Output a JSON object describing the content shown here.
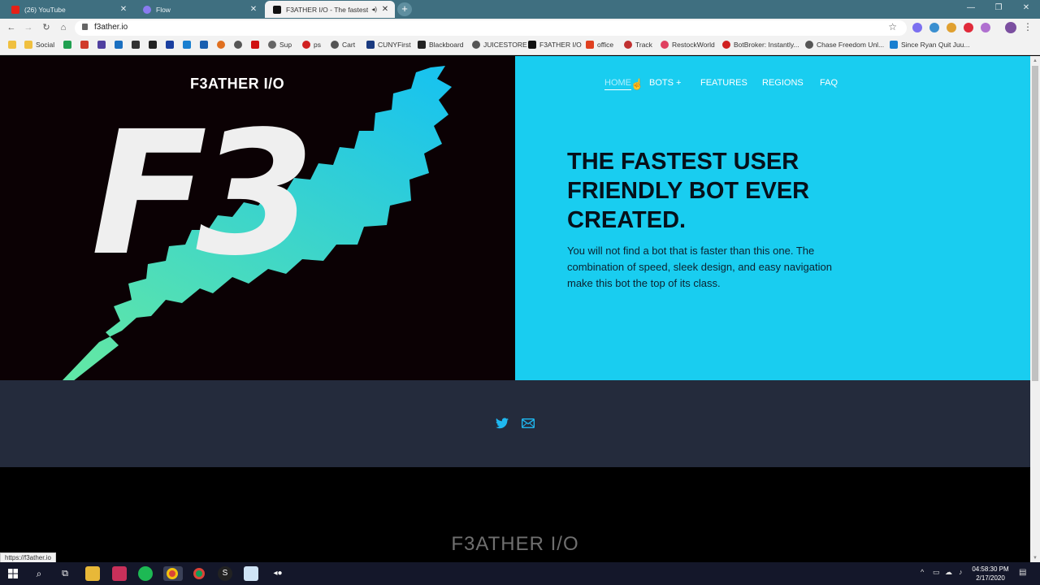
{
  "browser": {
    "tabs": [
      {
        "title": "(26) YouTube",
        "active": false
      },
      {
        "title": "Flow",
        "active": false
      },
      {
        "title": "F3ATHER I/O - The fastest S...",
        "active": true
      }
    ],
    "url": "f3ather.io",
    "status_url": "https://f3ather.io",
    "bookmarks": [
      "Social",
      "Sup",
      "ps",
      "Cart",
      "CUNYFirst",
      "Blackboard",
      "JUICESTORE",
      "F3ATHER I/O",
      "office",
      "Track",
      "RestockWorld",
      "BotBroker: Instantly...",
      "Chase Freedom Unl...",
      "Since Ryan Quit Juu..."
    ]
  },
  "site": {
    "brand": "F3ATHER I/O",
    "logo_text": "F3",
    "nav": [
      "HOME",
      "BOTS +",
      "FEATURES",
      "REGIONS",
      "FAQ"
    ],
    "headline": "THE FASTEST USER FRIENDLY BOT EVER CREATED.",
    "paragraph": "You will not find a bot that is faster than this one. The combination of speed, sleek design, and easy navigation make this bot the top of its class.",
    "social_icons": [
      "twitter-icon",
      "mail-icon"
    ],
    "footer_brand": "F3ATHER I/O",
    "colors": {
      "accent": "#19cdf0",
      "dark": "#0b0104",
      "social_bg": "#242b3c",
      "feather_top": "#19c3ee",
      "feather_bottom": "#5fe6a8"
    }
  },
  "taskbar": {
    "time": "04:58:30 PM",
    "date": "2/17/2020"
  }
}
